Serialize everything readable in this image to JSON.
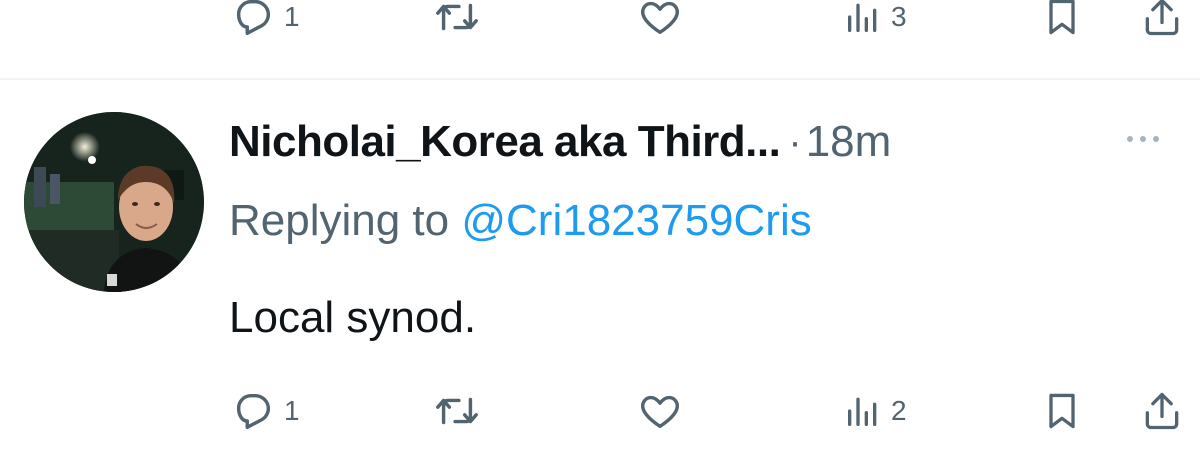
{
  "top_actions": {
    "reply_count": "1",
    "retweet_count": "",
    "like_count": "",
    "views_count": "3"
  },
  "tweet": {
    "author_name": "Nicholai_Korea aka Third...",
    "separator": "·",
    "time": "18m",
    "replying_prefix": "Replying to ",
    "replying_handle": "@Cri1823759Cris",
    "text": "Local synod.",
    "actions": {
      "reply_count": "1",
      "retweet_count": "",
      "like_count": "",
      "views_count": "2"
    }
  },
  "colors": {
    "text": "#0f1419",
    "secondary": "#536471",
    "link": "#1d9bf0",
    "divider": "#eff3f4"
  },
  "icons": [
    "reply-icon",
    "retweet-icon",
    "like-icon",
    "views-icon",
    "bookmark-icon",
    "share-icon",
    "more-icon"
  ]
}
